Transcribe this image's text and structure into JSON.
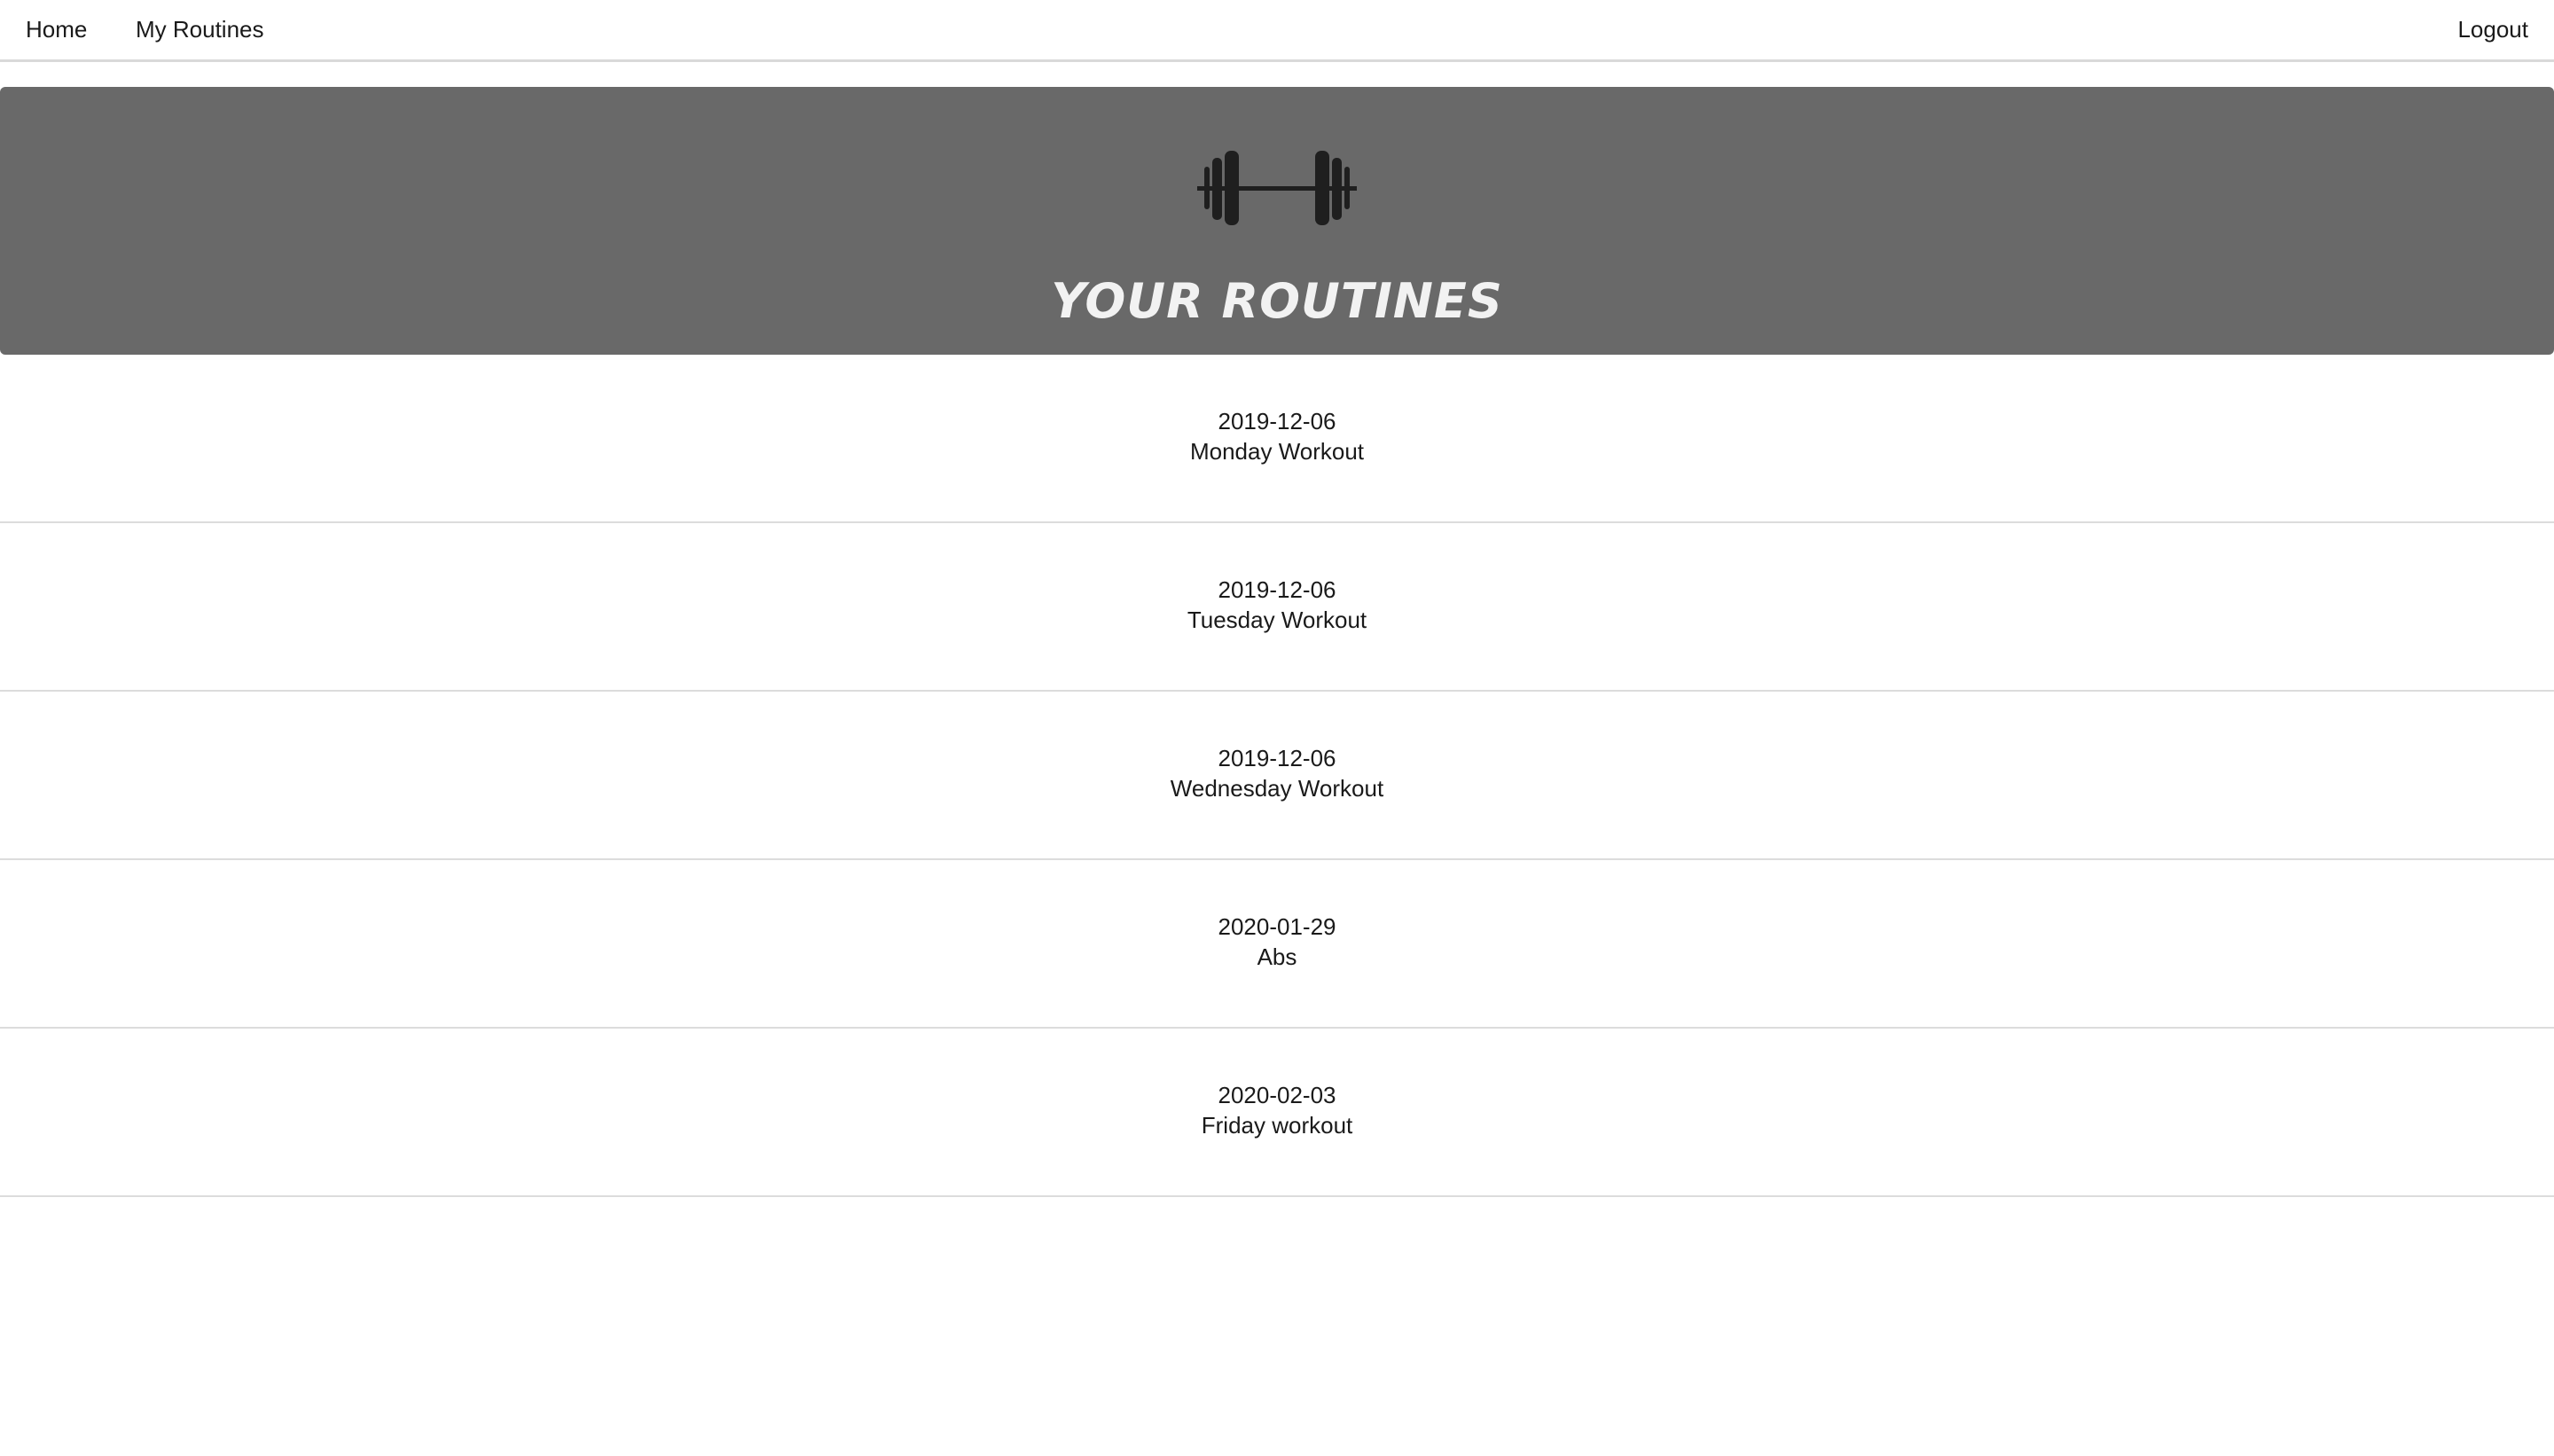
{
  "nav": {
    "home": "Home",
    "my_routines": "My Routines",
    "logout": "Logout"
  },
  "hero": {
    "icon": "dumbbell-icon",
    "title": "YOUR ROUTINES",
    "background_color": "#696969"
  },
  "routines": [
    {
      "date": "2019-12-06",
      "name": "Monday Workout"
    },
    {
      "date": "2019-12-06",
      "name": "Tuesday Workout"
    },
    {
      "date": "2019-12-06",
      "name": "Wednesday Workout"
    },
    {
      "date": "2020-01-29",
      "name": "Abs"
    },
    {
      "date": "2020-02-03",
      "name": "Friday workout"
    }
  ]
}
